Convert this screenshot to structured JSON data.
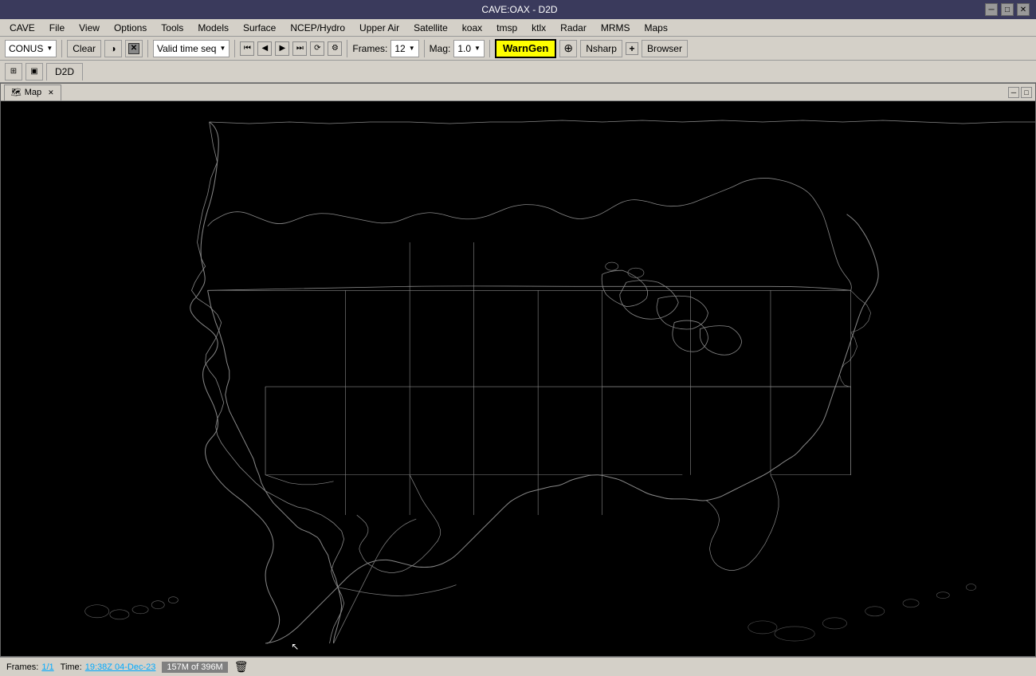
{
  "titlebar": {
    "title": "CAVE:OAX - D2D",
    "minimize": "─",
    "restore": "□",
    "close": "✕"
  },
  "menubar": {
    "items": [
      "CAVE",
      "File",
      "View",
      "Options",
      "Tools",
      "Models",
      "Surface",
      "NCEP/Hydro",
      "Upper Air",
      "Satellite",
      "koax",
      "tmsp",
      "ktlx",
      "Radar",
      "MRMS",
      "Maps"
    ]
  },
  "toolbar1": {
    "conus_label": "CONUS",
    "clear_label": "Clear",
    "valid_time_seq_label": "Valid time seq",
    "frames_label": "Frames:",
    "frames_value": "12",
    "mag_label": "Mag:",
    "mag_value": "1.0",
    "warngen_label": "WarnGen",
    "nsharp_label": "Nsharp",
    "browser_label": "Browser"
  },
  "toolbar2": {
    "d2d_icon": "D2D"
  },
  "map_panel": {
    "tab_label": "Map",
    "tab_close": "✕",
    "tab_minimize": "─",
    "tab_maximize": "□"
  },
  "statusbar": {
    "frames_label": "Frames:",
    "frames_value": "1/1",
    "time_label": "Time:",
    "time_value": "19:38Z 04-Dec-23",
    "memory_value": "157M of 396M"
  }
}
